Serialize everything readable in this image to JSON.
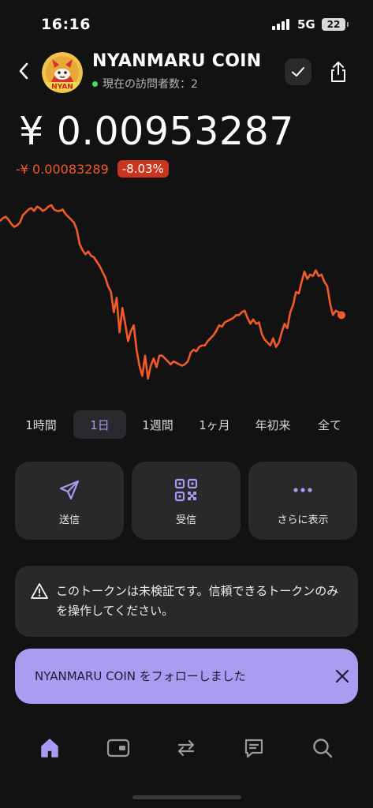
{
  "status_bar": {
    "time": "16:16",
    "network": "5G",
    "battery": "22"
  },
  "header": {
    "coin_name": "NYANMARU COIN",
    "visitors_label": "現在の訪問者数：2",
    "logo_text": "NYAN",
    "back_icon": "chevron-left-icon",
    "check_icon": "check-icon",
    "share_icon": "share-icon"
  },
  "price": {
    "current": "¥ 0.00953287",
    "change_abs": "-¥ 0.00083289",
    "change_pct": "-8.03%"
  },
  "colors": {
    "background": "#121212",
    "card": "#29292b",
    "accent": "#a69bf0",
    "negative": "#f35a2a",
    "badge": "#c8361f",
    "toast": "#a99df2",
    "online": "#4cd964"
  },
  "chart_data": {
    "type": "line",
    "series": [
      {
        "values": [
          0.01011,
          0.01013,
          0.01014,
          0.01012,
          0.01009,
          0.01007,
          0.01008,
          0.0101,
          0.01015,
          0.01017,
          0.01019,
          0.0102,
          0.01018,
          0.01021,
          0.0102,
          0.01018,
          0.01019,
          0.01021,
          0.01022,
          0.01019,
          0.01018,
          0.01018,
          0.01019,
          0.01016,
          0.01014,
          0.01012,
          0.0101,
          0.01005,
          0.00995,
          0.00991,
          0.00988,
          0.0099,
          0.00987,
          0.00986,
          0.00983,
          0.0098,
          0.00976,
          0.00972,
          0.00966,
          0.00962,
          0.00948,
          0.00958,
          0.00934,
          0.00951,
          0.0094,
          0.00928,
          0.00935,
          0.00939,
          0.00922,
          0.00911,
          0.00904,
          0.00918,
          0.00902,
          0.00911,
          0.00916,
          0.0091,
          0.00918,
          0.00918,
          0.00916,
          0.00914,
          0.00912,
          0.00914,
          0.00913,
          0.00912,
          0.00911,
          0.00912,
          0.00914,
          0.0092,
          0.00922,
          0.00921,
          0.00924,
          0.00925,
          0.00925,
          0.00928,
          0.0093,
          0.00932,
          0.00935,
          0.00939,
          0.00938,
          0.00941,
          0.00942,
          0.00943,
          0.00944,
          0.00946,
          0.00946,
          0.00948,
          0.00949,
          0.00944,
          0.0094,
          0.00943,
          0.0094,
          0.00941,
          0.00933,
          0.00929,
          0.00927,
          0.00925,
          0.0093,
          0.00924,
          0.00927,
          0.00934,
          0.0094,
          0.00937,
          0.00948,
          0.00953,
          0.00962,
          0.00961,
          0.00969,
          0.00976,
          0.00971,
          0.00974,
          0.00973,
          0.00977,
          0.00973,
          0.00974,
          0.00969,
          0.00966,
          0.00954,
          0.00946,
          0.00949,
          0.00948,
          0.00946
        ]
      }
    ],
    "last_point_marker": true,
    "grid": false,
    "legend": "none"
  },
  "ranges": {
    "items": [
      "1時間",
      "1日",
      "1週間",
      "1ヶ月",
      "年初来",
      "全て"
    ],
    "active_index": 1
  },
  "actions": {
    "send": {
      "label": "送信",
      "icon": "send-icon"
    },
    "receive": {
      "label": "受信",
      "icon": "qr-code-icon"
    },
    "more": {
      "label": "さらに表示",
      "icon": "more-icon"
    }
  },
  "warning": {
    "icon": "warning-icon",
    "text": "このトークンは未検証です。信頼できるトークンのみを操作してください。"
  },
  "toast": {
    "text": "NYANMARU COIN をフォローしました",
    "close_icon": "close-icon"
  },
  "bottom_nav": {
    "items": [
      "home-icon",
      "wallet-icon",
      "swap-icon",
      "chat-icon",
      "search-icon"
    ],
    "active_index": 0
  }
}
